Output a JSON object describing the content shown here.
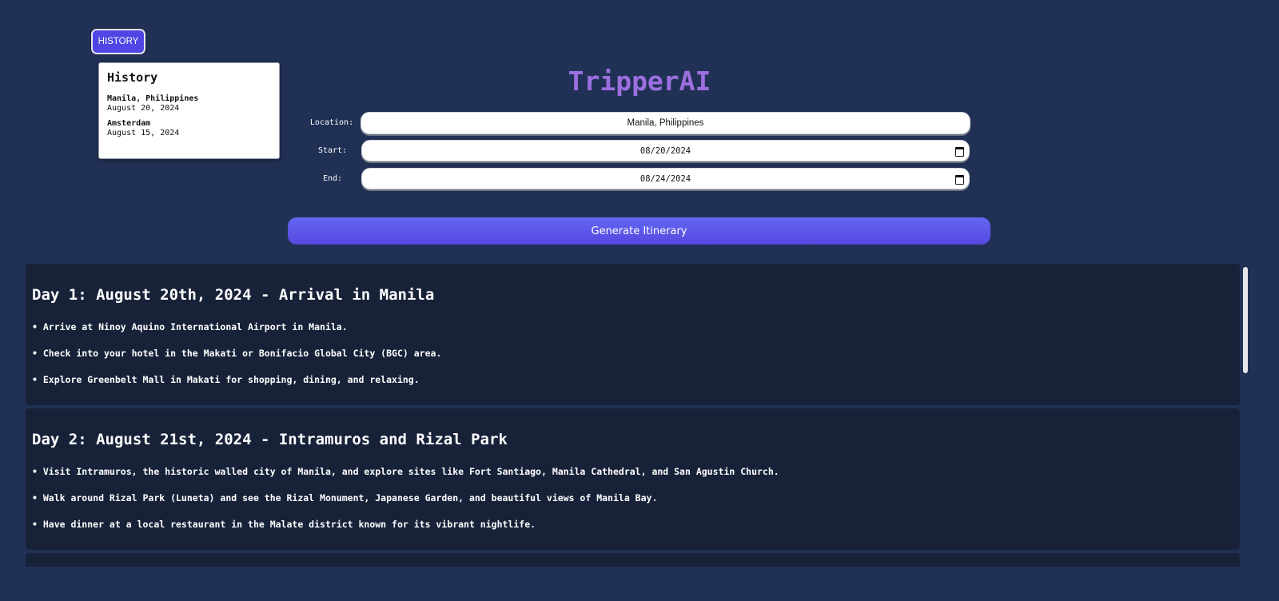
{
  "history_button": {
    "label": "HISTORY"
  },
  "history_panel": {
    "title": "History",
    "entries": [
      {
        "location": "Manila, Philippines",
        "date": "August 20, 2024"
      },
      {
        "location": "Amsterdam",
        "date": "August 15, 2024"
      }
    ]
  },
  "app": {
    "title": "TripperAI"
  },
  "form": {
    "location": {
      "label": "Location:",
      "value": "Manila, Philippines"
    },
    "start": {
      "label": "Start:",
      "value": "08/20/2024"
    },
    "end": {
      "label": "End:",
      "value": "08/24/2024"
    },
    "generate_label": "Generate Itinerary"
  },
  "itinerary": {
    "days": [
      {
        "title": "Day 1: August 20th, 2024 - Arrival in Manila",
        "items": [
          "• Arrive at Ninoy Aquino International Airport in Manila.",
          "• Check into your hotel in the Makati or Bonifacio Global City (BGC) area.",
          "• Explore Greenbelt Mall in Makati for shopping, dining, and relaxing."
        ]
      },
      {
        "title": "Day 2: August 21st, 2024 - Intramuros and Rizal Park",
        "items": [
          "• Visit Intramuros, the historic walled city of Manila, and explore sites like Fort Santiago, Manila Cathedral, and San Agustin Church.",
          "• Walk around Rizal Park (Luneta) and see the Rizal Monument, Japanese Garden, and beautiful views of Manila Bay.",
          "• Have dinner at a local restaurant in the Malate district known for its vibrant nightlife."
        ]
      }
    ]
  },
  "colors": {
    "background": "#213155",
    "card": "#172239",
    "accent": "#4f46e5",
    "title": "#9b6fe0"
  },
  "icons": {
    "date_picker": "calendar-icon"
  }
}
